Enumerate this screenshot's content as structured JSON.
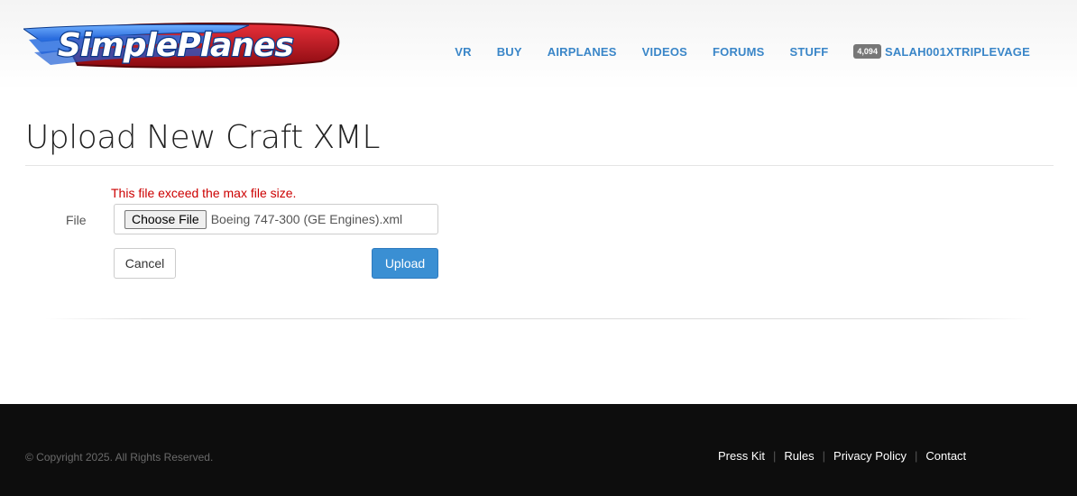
{
  "logo": {
    "text": "SimplePlanes"
  },
  "nav": {
    "items": [
      "VR",
      "BUY",
      "AIRPLANES",
      "VIDEOS",
      "FORUMS",
      "STUFF"
    ],
    "user_badge": "4,094",
    "username": "SALAH001XTRIPLEVAGE"
  },
  "page": {
    "title": "Upload New Craft XML"
  },
  "form": {
    "error": "This file exceed the max file size.",
    "file_label": "File",
    "choose_label": "Choose File",
    "file_name": "Boeing 747-300 (GE Engines).xml",
    "cancel_label": "Cancel",
    "upload_label": "Upload"
  },
  "footer": {
    "copyright": "© Copyright 2025. All Rights Reserved.",
    "links": [
      "Press Kit",
      "Rules",
      "Privacy Policy",
      "Contact"
    ]
  },
  "colors": {
    "nav_link": "#3a86c8",
    "error": "#cc0000",
    "primary_button": "#3a8fd3",
    "footer_bg": "#0d0d0d",
    "logo_red": "#c8101a",
    "logo_blue": "#1f5fd6"
  }
}
